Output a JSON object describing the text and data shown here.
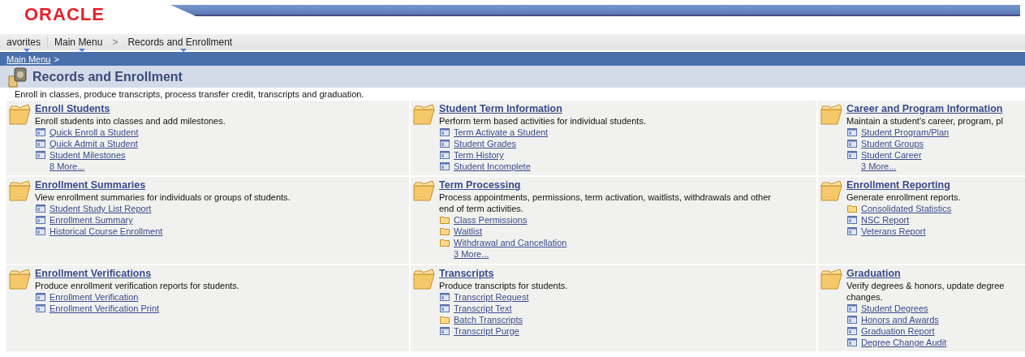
{
  "logo": "ORACLE",
  "menubar": [
    {
      "label": "avorites",
      "dropdown": true
    },
    {
      "label": "Main Menu",
      "dropdown": true
    },
    {
      "label": ">",
      "dropdown": false
    },
    {
      "label": "Records and Enrollment",
      "dropdown": true
    }
  ],
  "breadcrumb": {
    "link": "Main Menu",
    "separator": ">"
  },
  "page": {
    "title": "Records and Enrollment",
    "description": "Enroll in classes, produce transcripts, process transfer credit, transcripts and graduation."
  },
  "sections": [
    {
      "title": "Enroll Students",
      "description_lines": [
        "Enroll students into classes and add milestones."
      ],
      "links": [
        {
          "kind": "page",
          "label": "Quick Enroll a Student"
        },
        {
          "kind": "page",
          "label": "Quick Admit a Student"
        },
        {
          "kind": "page",
          "label": "Student Milestones"
        },
        {
          "kind": "more",
          "label": "8 More..."
        }
      ]
    },
    {
      "title": "Student Term Information",
      "description_lines": [
        "Perform term based activities for individual students."
      ],
      "links": [
        {
          "kind": "page",
          "label": "Term Activate a Student"
        },
        {
          "kind": "page",
          "label": "Student Grades"
        },
        {
          "kind": "page",
          "label": "Term History"
        },
        {
          "kind": "page",
          "label": "Student Incomplete"
        }
      ]
    },
    {
      "title": "Career and Program Information",
      "description_lines": [
        "Maintain a student's career, program, pl"
      ],
      "links": [
        {
          "kind": "page",
          "label": "Student Program/Plan"
        },
        {
          "kind": "page",
          "label": "Student Groups"
        },
        {
          "kind": "page",
          "label": "Student Career"
        },
        {
          "kind": "more",
          "label": "3 More..."
        }
      ]
    },
    {
      "title": "Enrollment Summaries",
      "description_lines": [
        "View enrollment summaries for individuals or groups of students."
      ],
      "links": [
        {
          "kind": "page",
          "label": "Student Study List Report"
        },
        {
          "kind": "page",
          "label": "Enrollment Summary"
        },
        {
          "kind": "page",
          "label": "Historical Course Enrollment"
        }
      ]
    },
    {
      "title": "Term Processing",
      "description_lines": [
        "Process appointments, permissions, term activation, waitlists, withdrawals and other",
        "end of term activities."
      ],
      "links": [
        {
          "kind": "folder",
          "label": "Class Permissions"
        },
        {
          "kind": "folder",
          "label": "Waitlist"
        },
        {
          "kind": "folder",
          "label": "Withdrawal and Cancellation"
        },
        {
          "kind": "more",
          "label": "3 More..."
        }
      ]
    },
    {
      "title": "Enrollment Reporting",
      "description_lines": [
        "Generate enrollment reports."
      ],
      "links": [
        {
          "kind": "folder",
          "label": "Consolidated Statistics"
        },
        {
          "kind": "page",
          "label": "NSC Report"
        },
        {
          "kind": "page",
          "label": "Veterans Report"
        }
      ]
    },
    {
      "title": "Enrollment Verifications",
      "description_lines": [
        "Produce enrollment verification reports for students."
      ],
      "links": [
        {
          "kind": "page",
          "label": "Enrollment Verification"
        },
        {
          "kind": "page",
          "label": "Enrollment Verification Print"
        }
      ]
    },
    {
      "title": "Transcripts",
      "description_lines": [
        "Produce transcripts for students."
      ],
      "links": [
        {
          "kind": "page",
          "label": "Transcript Request"
        },
        {
          "kind": "page",
          "label": "Transcript Text"
        },
        {
          "kind": "folder",
          "label": "Batch Transcripts"
        },
        {
          "kind": "page",
          "label": "Transcript Purge"
        }
      ]
    },
    {
      "title": "Graduation",
      "description_lines": [
        "Verify degrees & honors, update degree",
        "changes."
      ],
      "links": [
        {
          "kind": "page",
          "label": "Student Degrees"
        },
        {
          "kind": "page",
          "label": "Honors and Awards"
        },
        {
          "kind": "page",
          "label": "Graduation Report"
        },
        {
          "kind": "page",
          "label": "Degree Change Audit"
        }
      ]
    }
  ]
}
